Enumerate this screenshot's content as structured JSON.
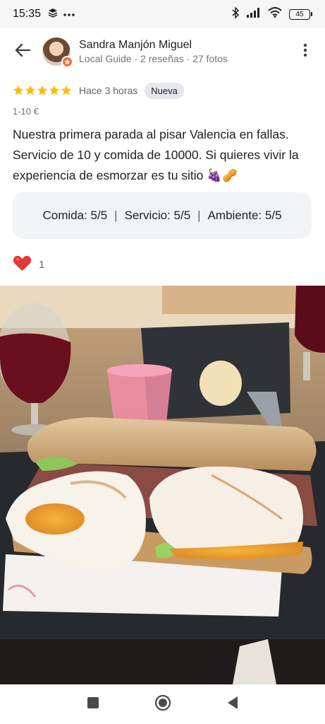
{
  "status_bar": {
    "time": "15:35",
    "battery": "45",
    "icons": [
      "layers-icon",
      "more-dots-icon",
      "bluetooth-icon",
      "signal-icon",
      "wifi-icon",
      "battery-icon"
    ]
  },
  "header": {
    "user_name": "Sandra Manjón Miguel",
    "user_meta": "Local Guide · 2 reseñas · 27 fotos",
    "icons": [
      "back-arrow-icon",
      "local-guide-star-icon",
      "more-vert-icon"
    ]
  },
  "review": {
    "stars": 5,
    "time_ago": "Hace 3 horas",
    "badge": "Nueva",
    "price": "1-10 €",
    "text": "Nuestra primera parada al pisar Valencia en fallas. Servicio de 10 y comida de 10000. Si quieres vivir la experiencia de esmorzar es tu sitio 🍇🥜",
    "aspects": {
      "food_label": "Comida",
      "food_value": "5/5",
      "service_label": "Servicio",
      "service_value": "5/5",
      "ambience_label": "Ambiente",
      "ambience_value": "5/5",
      "separator": "|",
      "colon": ":"
    },
    "likes": "1"
  },
  "colors": {
    "star": "#fbbc04",
    "heart": "#e53935",
    "badge_bg": "#e4e8ed",
    "ratings_box_bg": "#f1f3f4",
    "guide_badge": "#f2703a"
  },
  "nav_bar": {
    "icons": [
      "recents-square-icon",
      "home-circle-icon",
      "back-triangle-icon"
    ]
  }
}
